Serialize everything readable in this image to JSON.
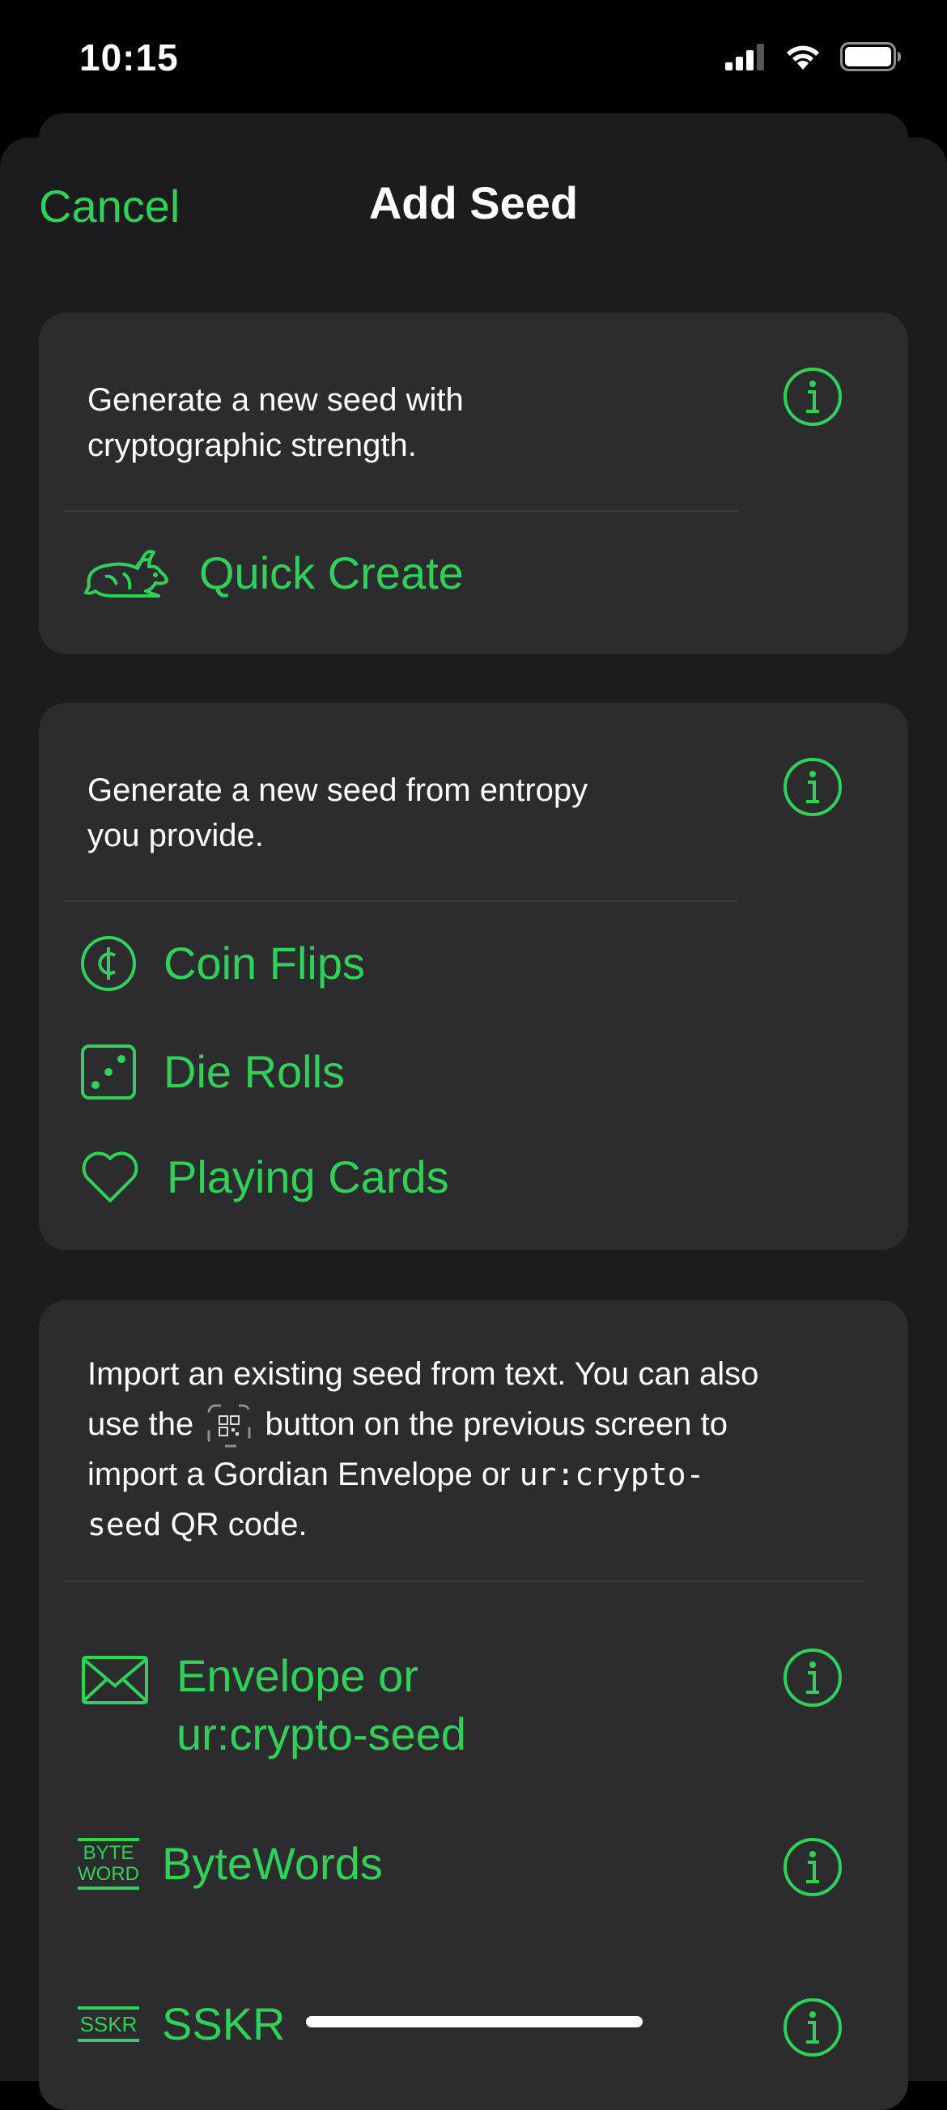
{
  "status_bar": {
    "time": "10:15",
    "icons": [
      "signal-icon",
      "wifi-icon",
      "battery-icon"
    ]
  },
  "nav": {
    "cancel_label": "Cancel",
    "title": "Add Seed"
  },
  "sections": {
    "quick": {
      "description": "Generate a new seed with cryptographic strength.",
      "desc_line1": "Generate a new seed with",
      "desc_line2": "cryptographic strength.",
      "item": {
        "label": "Quick Create",
        "icon": "rabbit-icon"
      }
    },
    "entropy": {
      "desc_line1": "Generate a new seed from entropy",
      "desc_line2": "you provide.",
      "items": [
        {
          "label": "Coin Flips",
          "icon": "coin-icon"
        },
        {
          "label": "Die Rolls",
          "icon": "die-icon"
        },
        {
          "label": "Playing Cards",
          "icon": "heart-icon"
        }
      ]
    },
    "import": {
      "desc_line1": "Import an existing seed from text. You can also",
      "desc_line2_pre": "use the",
      "desc_line2_post": "button on the previous screen to",
      "desc_line3_pre": "import a Gordian Envelope or ",
      "desc_line3_code": "ur:crypto-",
      "desc_line4_code": "seed",
      "desc_line4_post": " QR code.",
      "items": [
        {
          "label_line1": "Envelope or",
          "label_line2": "ur:crypto-seed",
          "icon": "envelope-icon"
        },
        {
          "label": "ByteWords",
          "icon": "bytewords-icon",
          "icon_text_1": "BYTE",
          "icon_text_2": "WORD"
        },
        {
          "label": "SSKR",
          "icon": "sskr-icon",
          "icon_text": "SSKR"
        }
      ]
    }
  },
  "colors": {
    "accent": "#30d158",
    "background": "#1c1c1e",
    "card": "#2c2c2e"
  }
}
